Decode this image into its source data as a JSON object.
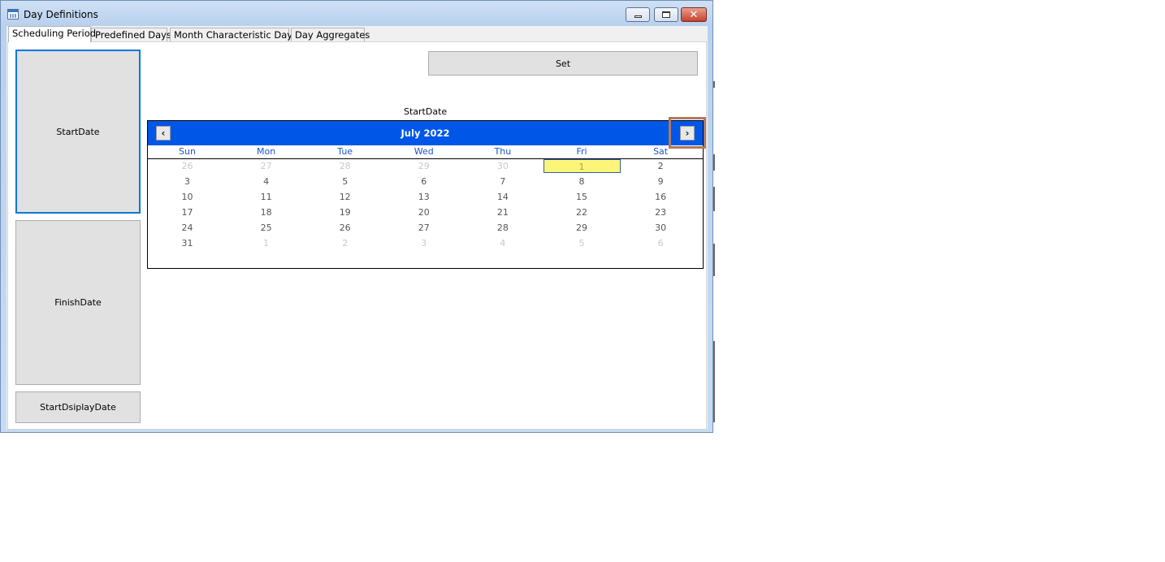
{
  "window": {
    "title": "Day Definitions",
    "icon": "calendar-app-icon"
  },
  "tabs": [
    {
      "label": "Scheduling Period",
      "active": true
    },
    {
      "label": "Predefined Days",
      "active": false
    },
    {
      "label": "Month Characteristic Days",
      "active": false
    },
    {
      "label": "Day Aggregates",
      "active": false
    }
  ],
  "left_buttons": {
    "start_date": "StartDate",
    "finish_date": "FinishDate",
    "start_display_date": "StartDsiplayDate"
  },
  "set_button": "Set",
  "calendar_label": "StartDate",
  "calendar": {
    "month_title": "July 2022",
    "prev_icon": "chevron-left-icon",
    "next_icon": "chevron-right-icon",
    "header_color": "#0057e7",
    "weekdays": [
      "Sun",
      "Mon",
      "Tue",
      "Wed",
      "Thu",
      "Fri",
      "Sat"
    ],
    "weeks": [
      [
        "26",
        "27",
        "28",
        "29",
        "30",
        "1",
        "2"
      ],
      [
        "3",
        "4",
        "5",
        "6",
        "7",
        "8",
        "9"
      ],
      [
        "10",
        "11",
        "12",
        "13",
        "14",
        "15",
        "16"
      ],
      [
        "17",
        "18",
        "19",
        "20",
        "21",
        "22",
        "23"
      ],
      [
        "24",
        "25",
        "26",
        "27",
        "28",
        "29",
        "30"
      ],
      [
        "31",
        "1",
        "2",
        "3",
        "4",
        "5",
        "6"
      ]
    ],
    "other_month": [
      [
        true,
        true,
        true,
        true,
        true,
        false,
        false
      ],
      [
        false,
        false,
        false,
        false,
        false,
        false,
        false
      ],
      [
        false,
        false,
        false,
        false,
        false,
        false,
        false
      ],
      [
        false,
        false,
        false,
        false,
        false,
        false,
        false
      ],
      [
        false,
        false,
        false,
        false,
        false,
        false,
        false
      ],
      [
        false,
        true,
        true,
        true,
        true,
        true,
        true
      ]
    ],
    "today": "1",
    "today_color": "#fbf67a"
  }
}
